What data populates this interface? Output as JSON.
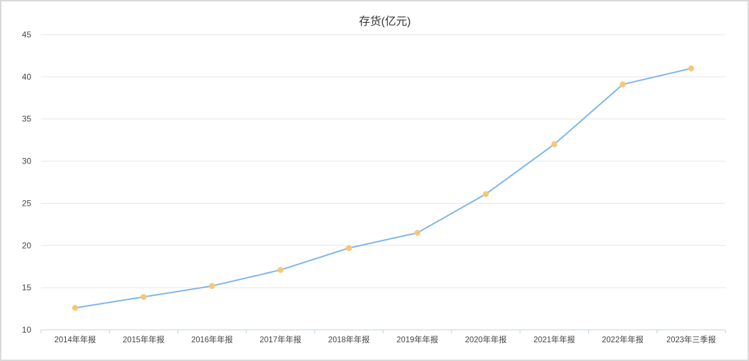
{
  "chart_data": {
    "type": "line",
    "title": "存货(亿元)",
    "xlabel": "",
    "ylabel": "",
    "categories": [
      "2014年年报",
      "2015年年报",
      "2016年年报",
      "2017年年报",
      "2018年年报",
      "2019年年报",
      "2020年年报",
      "2021年年报",
      "2022年年报",
      "2023年三季报"
    ],
    "series": [
      {
        "values": [
          12.6,
          13.9,
          15.2,
          17.1,
          19.7,
          21.5,
          26.1,
          32.0,
          39.1,
          41.0
        ]
      }
    ],
    "ylim": [
      10,
      45
    ],
    "yticks": [
      10,
      15,
      20,
      25,
      30,
      35,
      40,
      45
    ],
    "grid": true,
    "legend": "none",
    "colors": {
      "line": "#7cb5ec",
      "marker": "#f7c873",
      "grid": "#e6e6e6",
      "axis": "#c0d0e0"
    }
  }
}
